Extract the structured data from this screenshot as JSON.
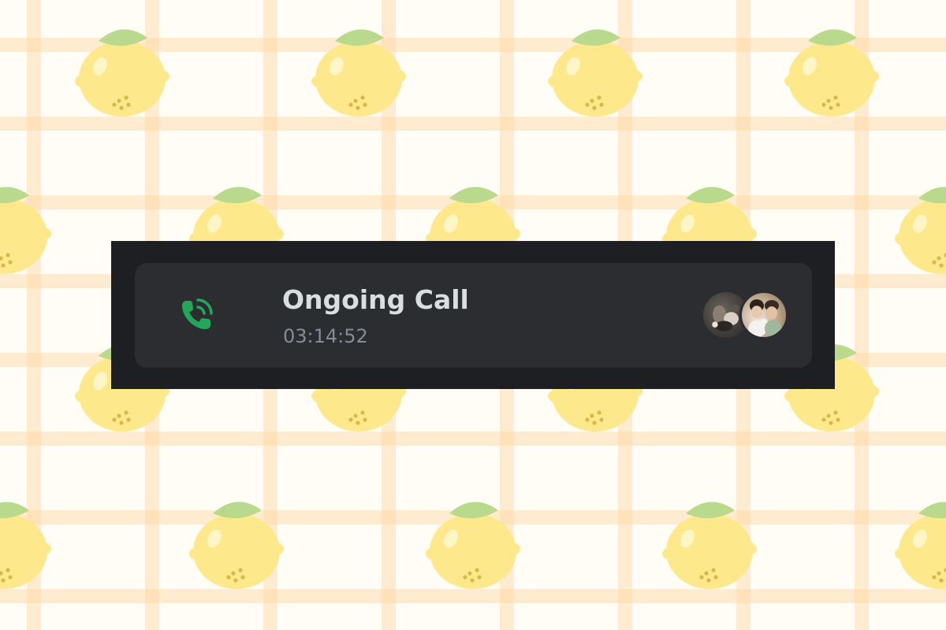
{
  "call": {
    "title": "Ongoing Call",
    "duration": "03:14:52",
    "status_icon": "phone-calling-icon",
    "accent_color": "#23a55a",
    "participants": [
      {
        "avatar": "participant-avatar-1"
      },
      {
        "avatar": "participant-avatar-2"
      }
    ]
  },
  "background": {
    "pattern": "lemon-gingham"
  }
}
